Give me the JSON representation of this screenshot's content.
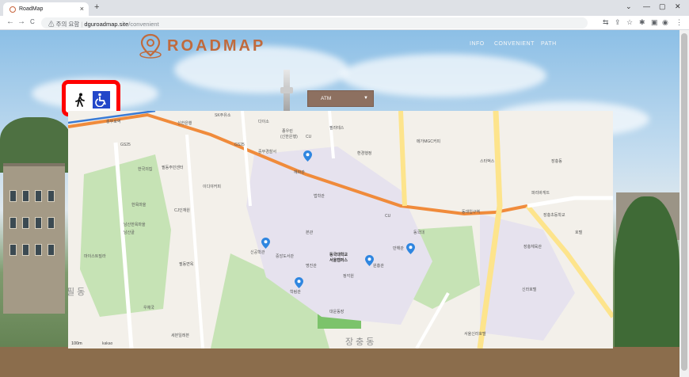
{
  "browser": {
    "tab_title": "RoadMap",
    "tab_close": "×",
    "new_tab": "+",
    "window_controls": [
      "⌄",
      "—",
      "▢",
      "✕"
    ],
    "nav_buttons": [
      "←",
      "→",
      "C"
    ],
    "security_label": "주의 요함",
    "url_host": "dguroadmap.site",
    "url_path": "/convenient",
    "toolbar_icons": [
      "translate-icon",
      "share-icon",
      "star-icon",
      "extensions-icon",
      "sidebar-icon",
      "profile-icon",
      "more-icon"
    ]
  },
  "header": {
    "logo_text": "ROADMAP",
    "menu": [
      "INFO",
      "CONVENIENT",
      "PATH"
    ]
  },
  "transport_modes": [
    {
      "name": "walk",
      "icon": "pedestrian-icon"
    },
    {
      "name": "wheelchair",
      "icon": "wheelchair-icon"
    }
  ],
  "facility_select": {
    "selected": "ATM"
  },
  "map": {
    "watermark_labels": [
      "필동",
      "장충동"
    ],
    "labels": [
      "SK주유소",
      "신한은행",
      "다이소",
      "종우린",
      "(신한은행)",
      "GS25",
      "필라테스",
      "중부경찰서",
      "환경행정",
      "CU",
      "메가MGC커피",
      "동국대학교",
      "서울캠퍼스",
      "장충체육관",
      "동국대",
      "신라호텔",
      "서울신라호텔",
      "장충동",
      "남산한옥마을",
      "한국의집",
      "CJ인재원",
      "필동주민센터",
      "이디야커피",
      "충무로역",
      "GS25",
      "동대입구역",
      "혜화관",
      "본관",
      "명진관",
      "중앙도서관",
      "법학관",
      "정각원",
      "원흥관",
      "신공학관",
      "대운동장",
      "학림관",
      "만해관",
      "장충초등학교",
      "마이스트빌라",
      "파리바게뜨",
      "스타벅스",
      "우체국",
      "세븐일레븐",
      "한옥마을",
      "남산골",
      "필동면옥",
      "CU",
      "호텔"
    ],
    "scale": "100m",
    "attribution": "kakao"
  },
  "colors": {
    "accent": "#c06a3c",
    "mode_box_border": "#ff0000",
    "wheelchair_bg": "#2347c9",
    "select_bg": "#8d7060",
    "pin": "#2f86e0",
    "main_road": "#f08b3b",
    "subway_line": "#3a7bd5"
  }
}
